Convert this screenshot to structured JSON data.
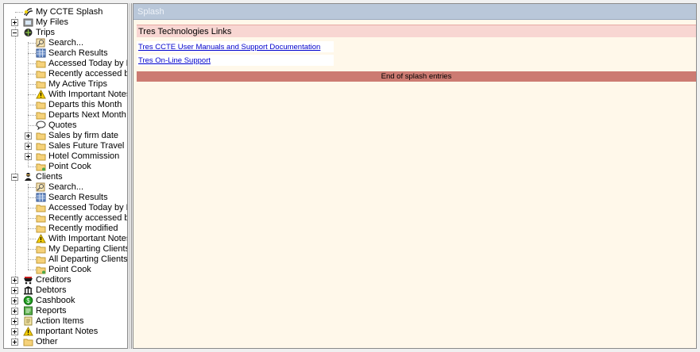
{
  "tree": {
    "items": [
      {
        "label": "My CCTE Splash",
        "icon": "splash-icon"
      },
      {
        "label": "My Files",
        "icon": "files-icon"
      },
      {
        "label": "Trips",
        "icon": "trips-icon"
      },
      {
        "label": "Search...",
        "icon": "search-icon"
      },
      {
        "label": "Search Results",
        "icon": "grid-icon"
      },
      {
        "label": "Accessed Today by Me",
        "icon": "folder-icon"
      },
      {
        "label": "Recently accessed by me",
        "icon": "folder-icon"
      },
      {
        "label": "My Active Trips",
        "icon": "folder-icon"
      },
      {
        "label": "With Important Notes",
        "icon": "warning-icon"
      },
      {
        "label": "Departs this Month",
        "icon": "folder-icon"
      },
      {
        "label": "Departs Next Month",
        "icon": "folder-icon"
      },
      {
        "label": "Quotes",
        "icon": "speech-bubble-icon"
      },
      {
        "label": "Sales by firm date",
        "icon": "folder-icon"
      },
      {
        "label": "Sales Future Travel",
        "icon": "folder-icon"
      },
      {
        "label": "Hotel Commission",
        "icon": "folder-icon"
      },
      {
        "label": "Point Cook",
        "icon": "shared-folder-icon"
      },
      {
        "label": "Clients",
        "icon": "clients-icon"
      },
      {
        "label": "Search...",
        "icon": "search-icon"
      },
      {
        "label": "Search Results",
        "icon": "grid-icon"
      },
      {
        "label": "Accessed Today by Me",
        "icon": "folder-icon"
      },
      {
        "label": "Recently accessed by me",
        "icon": "folder-icon"
      },
      {
        "label": "Recently modified",
        "icon": "folder-icon"
      },
      {
        "label": "With Important Notes",
        "icon": "warning-icon"
      },
      {
        "label": "My Departing Clients",
        "icon": "folder-icon"
      },
      {
        "label": "All Departing Clients",
        "icon": "folder-icon"
      },
      {
        "label": "Point Cook",
        "icon": "shared-folder-icon"
      },
      {
        "label": "Creditors",
        "icon": "creditors-icon"
      },
      {
        "label": "Debtors",
        "icon": "debtors-icon"
      },
      {
        "label": "Cashbook",
        "icon": "cashbook-icon"
      },
      {
        "label": "Reports",
        "icon": "reports-icon"
      },
      {
        "label": "Action Items",
        "icon": "action-items-icon"
      },
      {
        "label": "Important Notes",
        "icon": "warning-icon"
      },
      {
        "label": "Other",
        "icon": "folder-icon"
      }
    ]
  },
  "pane": {
    "title": "Splash",
    "section_header": "Tres Technologies Links",
    "links": [
      {
        "label": "Tres CCTE User Manuals and Support Documentation"
      },
      {
        "label": "Tres On-Line Support"
      }
    ],
    "end_label": "End of splash entries"
  },
  "colors": {
    "pane_background": "#fff8ea",
    "title_bar": "#b9c7d9",
    "section_header": "#f8d6d2",
    "end_bar": "#cc7b72",
    "link": "#0000cc"
  }
}
